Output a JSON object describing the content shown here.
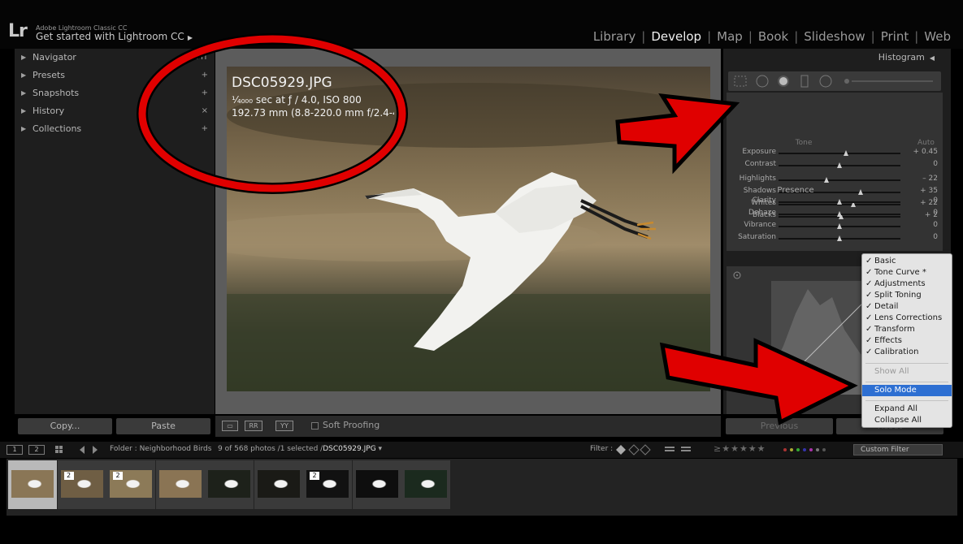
{
  "header": {
    "app_name": "Adobe Lightroom Classic CC",
    "identity": "Get started with Lightroom CC",
    "logo": "Lr",
    "modules": [
      "Library",
      "Develop",
      "Map",
      "Book",
      "Slideshow",
      "Print",
      "Web"
    ],
    "active_module": "Develop"
  },
  "left_panel": {
    "items": [
      {
        "label": "Navigator",
        "action": "FIT"
      },
      {
        "label": "Presets",
        "action": "+"
      },
      {
        "label": "Snapshots",
        "action": "+"
      },
      {
        "label": "History",
        "action": "×"
      },
      {
        "label": "Collections",
        "action": "+"
      }
    ],
    "copy_label": "Copy...",
    "paste_label": "Paste"
  },
  "image_info": {
    "filename": "DSC05929.JPG",
    "exposure": "¹⁄₄₀₀₀ sec at ƒ / 4.0, ISO 800",
    "lens": "192.73 mm (8.8-220.0 mm f/2.4-4.0)"
  },
  "toolbar": {
    "soft_proofing_label": "Soft Proofing",
    "soft_proofing_checked": false
  },
  "right_panel": {
    "histogram_label": "Histogram",
    "tone_label": "Tone",
    "auto_label": "Auto",
    "tone_sliders": [
      {
        "label": "Exposure",
        "value": "+ 0.45",
        "pos": 0.55
      },
      {
        "label": "Contrast",
        "value": "0",
        "pos": 0.5
      }
    ],
    "tone_sliders_2": [
      {
        "label": "Highlights",
        "value": "– 22",
        "pos": 0.39
      },
      {
        "label": "Shadows",
        "value": "+ 35",
        "pos": 0.67
      },
      {
        "label": "Whites",
        "value": "+ 22",
        "pos": 0.61
      },
      {
        "label": "Blacks",
        "value": "+ 2",
        "pos": 0.51
      }
    ],
    "presence_label": "Presence",
    "presence_sliders": [
      {
        "label": "Clarity",
        "value": "0",
        "pos": 0.5
      },
      {
        "label": "Dehaze",
        "value": "0",
        "pos": 0.5
      },
      {
        "label": "Vibrance",
        "value": "0",
        "pos": 0.5
      },
      {
        "label": "Saturation",
        "value": "0",
        "pos": 0.5
      }
    ],
    "previous_label": "Previous",
    "reset_label": "Reset"
  },
  "context_menu": {
    "panels": [
      {
        "label": "Basic",
        "checked": true
      },
      {
        "label": "Tone Curve *",
        "checked": true
      },
      {
        "label": "Adjustments",
        "checked": true
      },
      {
        "label": "Split Toning",
        "checked": true
      },
      {
        "label": "Detail",
        "checked": true
      },
      {
        "label": "Lens Corrections",
        "checked": true
      },
      {
        "label": "Transform",
        "checked": true
      },
      {
        "label": "Effects",
        "checked": true
      },
      {
        "label": "Calibration",
        "checked": true
      }
    ],
    "show_all": "Show All",
    "solo_mode": "Solo Mode",
    "expand_all": "Expand All",
    "collapse_all": "Collapse All"
  },
  "filmstrip_bar": {
    "screen1": "1",
    "screen2": "2",
    "folder": "Folder : Neighborhood Birds",
    "count": "9 of 568 photos /1 selected /",
    "selected_file": "DSC05929.JPG",
    "filter_label": "Filter :",
    "custom_filter": "Custom Filter"
  },
  "filmstrip": {
    "thumbs": [
      {
        "badge": "",
        "selected": true
      },
      {
        "badge": "2",
        "selected": false
      },
      {
        "badge": "2",
        "selected": false
      },
      {
        "badge": "",
        "selected": false
      },
      {
        "badge": "",
        "selected": false
      },
      {
        "badge": "",
        "selected": false
      },
      {
        "badge": "2",
        "selected": false
      },
      {
        "badge": "",
        "selected": false
      },
      {
        "badge": "",
        "selected": false
      }
    ]
  },
  "colors": {
    "annotation_red": "#e00000",
    "menu_highlight": "#2d6fd2"
  }
}
